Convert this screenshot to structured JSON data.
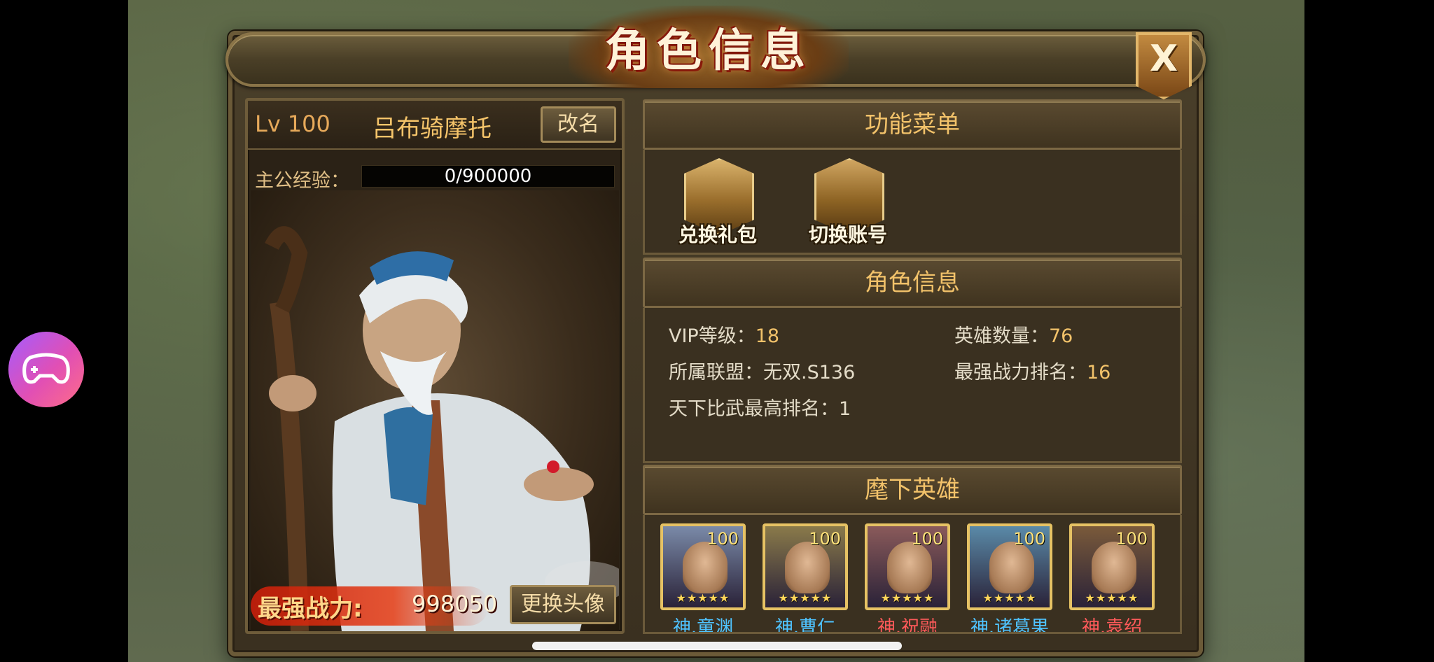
{
  "dialog": {
    "title": "角色信息",
    "close_label": "X"
  },
  "player": {
    "level_prefix": "Lv",
    "level": "100",
    "name": "吕布骑摩托",
    "rename_label": "改名",
    "exp_label": "主公经验：",
    "exp_value": "0/900000",
    "power_label": "最强战力:",
    "power_value": "998050",
    "change_avatar_label": "更换头像"
  },
  "function_menu": {
    "title": "功能菜单",
    "items": [
      {
        "label": "兑换礼包",
        "icon": "gift-chest-icon"
      },
      {
        "label": "切换账号",
        "icon": "switch-account-icon"
      }
    ]
  },
  "role_info": {
    "title": "角色信息",
    "vip_label": "VIP等级：",
    "vip_value": "18",
    "hero_count_label": "英雄数量：",
    "hero_count_value": "76",
    "alliance_label": "所属联盟：",
    "alliance_value": "无双.S136",
    "power_rank_label": "最强战力排名：",
    "power_rank_value": "16",
    "arena_rank_label": "天下比武最高排名：",
    "arena_rank_value": "1"
  },
  "heroes": {
    "title": "麾下英雄",
    "list": [
      {
        "name": "神.童渊",
        "level": "100",
        "stars": "★★★★★",
        "name_color": "#4fc3ff",
        "bg": "#7a8aa8"
      },
      {
        "name": "神.曹仁",
        "level": "100",
        "stars": "★★★★★",
        "name_color": "#4fc3ff",
        "bg": "#8a7a4a"
      },
      {
        "name": "神.祝融",
        "level": "100",
        "stars": "★★★★★",
        "name_color": "#ff5a5a",
        "bg": "#8a5a5a"
      },
      {
        "name": "神.诸葛果",
        "level": "100",
        "stars": "★★★★★",
        "name_color": "#4fc3ff",
        "bg": "#5a8aa8"
      },
      {
        "name": "神.袁绍",
        "level": "100",
        "stars": "★★★★★",
        "name_color": "#ff5a5a",
        "bg": "#7a5a3a"
      }
    ]
  },
  "colors": {
    "accent_gold": "#f2c26a",
    "panel_bg": "#3a3020",
    "frame": "#6b5a38"
  }
}
